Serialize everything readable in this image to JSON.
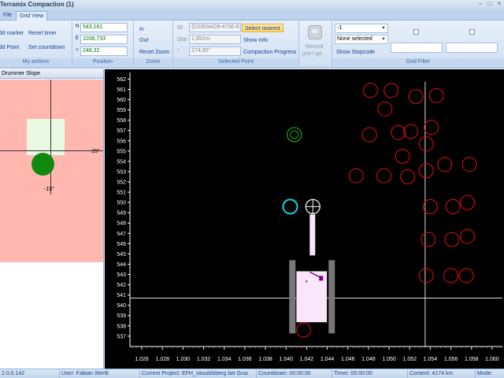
{
  "window": {
    "title": "Terramix Compaction (1)",
    "controls": [
      "–",
      "□",
      "×"
    ]
  },
  "tabs": [
    {
      "label": "File"
    },
    {
      "label": "Grid View"
    }
  ],
  "ribbon": {
    "actions": {
      "add_marker": "Add marker",
      "reset_timer": "Reset timer",
      "add_point": "Add Point",
      "set_countdown": "Set countdown",
      "label": "My actions"
    },
    "position": {
      "n_label": "N",
      "n_value": "543,181",
      "e_label": "E",
      "e_value": "1036,733",
      "z_label": "≈",
      "z_value": "248,32",
      "label": "Position"
    },
    "zoom": {
      "in": "In",
      "out": "Out",
      "reset": "Reset Zoom",
      "label": "Zoom"
    },
    "selected_point": {
      "id_label": "ID",
      "id_value": "{C0359AD9-4790-E",
      "dist_label": "Dist",
      "dist_value": "1,852m",
      "angle_label": "°",
      "angle_value": "274,90°",
      "select_nearest": "Select nearest",
      "show_info": "Show Info",
      "compaction_progress": "Compaction Progress",
      "label": "Selected Point"
    },
    "record": {
      "badge": "60",
      "label1": "Record",
      "label2": "just I go"
    },
    "grid_filter": {
      "dropdown1": "-1",
      "dropdown2": "None selected",
      "show_stopcode": "Show Stopcode",
      "label": "Grid Filter"
    }
  },
  "left_panel": {
    "title": "Drummer Slope",
    "label_right": "15°",
    "label_bottom": "-15°"
  },
  "chart_data": {
    "type": "scatter",
    "x_ticks": [
      "1.026",
      "1.028",
      "1.030",
      "1.032",
      "1.034",
      "1.036",
      "1.038",
      "1.040",
      "1.042",
      "1.044",
      "1.046",
      "1.048",
      "1.050",
      "1.052",
      "1.054",
      "1.056",
      "1.058",
      "1.060"
    ],
    "y_ticks": [
      "537",
      "538",
      "539",
      "540",
      "541",
      "542",
      "543",
      "544",
      "545",
      "546",
      "547",
      "548",
      "549",
      "550",
      "551",
      "552",
      "553",
      "554",
      "555",
      "556",
      "557",
      "558",
      "559",
      "560",
      "561",
      "562"
    ],
    "xlim": [
      1.025,
      1.061
    ],
    "ylim": [
      536.3,
      562.8
    ],
    "crosshair": {
      "x": 1.0535,
      "y": 540.7
    },
    "series": [
      {
        "color": "#e01010",
        "points": [
          [
            1.0482,
            560.9
          ],
          [
            1.0502,
            560.9
          ],
          [
            1.0526,
            560.3
          ],
          [
            1.0546,
            560.4
          ],
          [
            1.0496,
            559.1
          ],
          [
            1.0481,
            556.6
          ],
          [
            1.0509,
            556.8
          ],
          [
            1.0521,
            556.9
          ],
          [
            1.0536,
            555.7
          ],
          [
            1.0541,
            557.3
          ],
          [
            1.0513,
            554.5
          ],
          [
            1.0536,
            553.1
          ],
          [
            1.0468,
            552.6
          ],
          [
            1.0495,
            552.6
          ],
          [
            1.0518,
            552.5
          ],
          [
            1.0554,
            553.7
          ],
          [
            1.0578,
            553.7
          ],
          [
            1.054,
            549.6
          ],
          [
            1.0562,
            549.6
          ],
          [
            1.0576,
            550.0
          ],
          [
            1.0538,
            546.4
          ],
          [
            1.0561,
            546.4
          ],
          [
            1.0576,
            546.7
          ],
          [
            1.0536,
            542.9
          ],
          [
            1.056,
            542.9
          ],
          [
            1.0575,
            542.9
          ],
          [
            1.0417,
            537.6
          ]
        ]
      },
      {
        "color": "#1fa81f",
        "points": [
          [
            1.0408,
            556.6
          ]
        ]
      },
      {
        "color": "#14d2de",
        "points": [
          [
            1.0404,
            549.6
          ]
        ]
      },
      {
        "color": "#ffffff",
        "points": [
          [
            1.0426,
            549.6
          ]
        ]
      }
    ]
  },
  "status": {
    "version": "2.0.0.142",
    "user": "User: Fabian Wertli",
    "project": "Current Project: EFH_Vasoldsberg bei Graz",
    "countdown": "Countdown: 00:00:00",
    "timer": "Timer: 00:00:00",
    "content": "Content: 4174 km",
    "mode": "Mode:"
  }
}
